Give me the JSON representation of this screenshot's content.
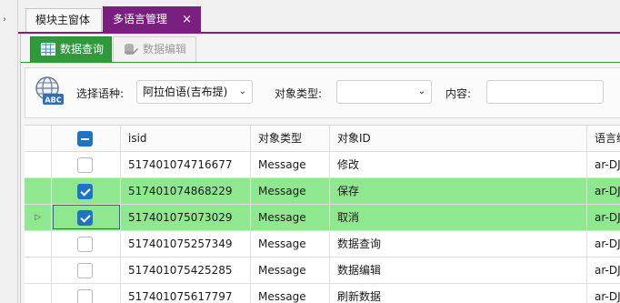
{
  "left_strip": {
    "icon": "chevron-icon"
  },
  "tabs": [
    {
      "label": "模块主窗体",
      "active": false
    },
    {
      "label": "多语言管理",
      "active": true,
      "close": "×"
    }
  ],
  "subtabs": [
    {
      "label": "数据查询",
      "icon": "table-grid-icon",
      "active": true
    },
    {
      "label": "数据编辑",
      "icon": "database-edit-icon",
      "active": false
    }
  ],
  "filters": {
    "globe_icon": "globe-abc-icon",
    "language_label": "选择语种:",
    "language_value": "阿拉伯语(吉布提)",
    "object_type_label": "对象类型:",
    "object_type_value": "",
    "content_label": "内容:",
    "content_value": ""
  },
  "grid": {
    "columns": [
      "isid",
      "对象类型",
      "对象ID",
      "语言编码"
    ],
    "select_all": "indeterminate",
    "rows": [
      {
        "checked": false,
        "selected": false,
        "current": false,
        "isid": "517401074716677",
        "type": "Message",
        "oid": "修改",
        "lang": "ar-DJ"
      },
      {
        "checked": true,
        "selected": true,
        "current": false,
        "isid": "517401074868229",
        "type": "Message",
        "oid": "保存",
        "lang": "ar-DJ"
      },
      {
        "checked": true,
        "selected": true,
        "current": true,
        "isid": "517401075073029",
        "type": "Message",
        "oid": "取消",
        "lang": "ar-DJ"
      },
      {
        "checked": false,
        "selected": false,
        "current": false,
        "isid": "517401075257349",
        "type": "Message",
        "oid": "数据查询",
        "lang": "ar-DJ"
      },
      {
        "checked": false,
        "selected": false,
        "current": false,
        "isid": "517401075425285",
        "type": "Message",
        "oid": "数据编辑",
        "lang": "ar-DJ"
      },
      {
        "checked": false,
        "selected": false,
        "current": false,
        "isid": "517401075617797",
        "type": "Message",
        "oid": "刷新数据",
        "lang": "ar-DJ"
      }
    ]
  },
  "colors": {
    "accent": "#7a1f7f",
    "green": "#2e9a3a",
    "selected_row": "#8fe88f",
    "checkbox": "#1f73c7"
  }
}
